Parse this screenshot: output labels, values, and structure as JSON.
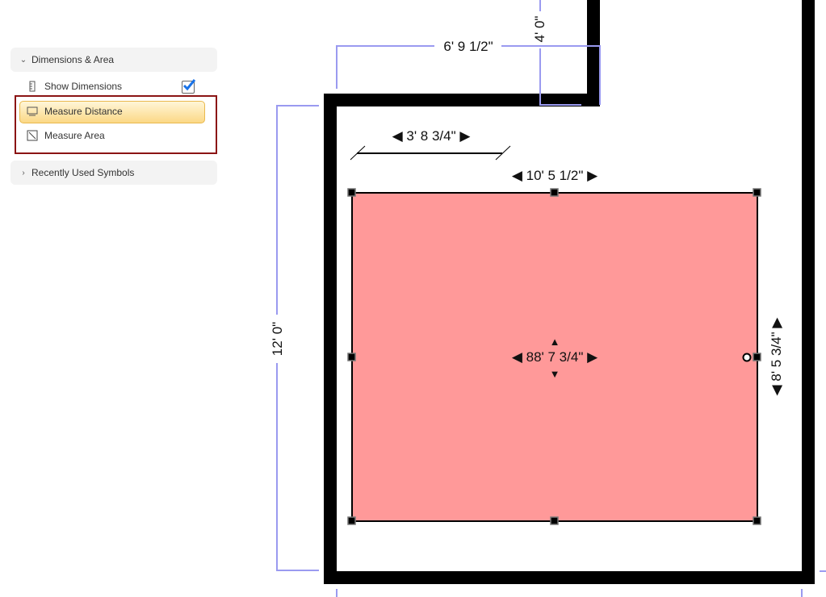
{
  "sidebar": {
    "sections": [
      {
        "label": "Dimensions & Area",
        "expanded": true,
        "chevron": "chevron-down-icon"
      },
      {
        "label": "Recently Used Symbols",
        "expanded": false,
        "chevron": "chevron-right-icon"
      }
    ],
    "items": [
      {
        "label": "Show Dimensions",
        "icon": "ruler-icon",
        "checked": true
      },
      {
        "label": "Measure Distance",
        "icon": "measure-distance-icon",
        "selected": true
      },
      {
        "label": "Measure Area",
        "icon": "measure-area-icon"
      }
    ]
  },
  "canvas": {
    "dimensions": {
      "top_wall": "6' 9 1/2\"",
      "notch_height": "4' 0\"",
      "left_wall": "12' 0\"",
      "measure_line": "3' 8 3/4\"",
      "area_width": "10' 5 1/2\"",
      "area_height": "8' 5 3/4\"",
      "area_total": "88' 7 3/4\""
    },
    "colors": {
      "wall": "#000000",
      "dimension_line": "#9a9af0",
      "area_fill": "#ff9999",
      "selection_border": "#8b1414",
      "highlight": "#fbd886"
    }
  }
}
